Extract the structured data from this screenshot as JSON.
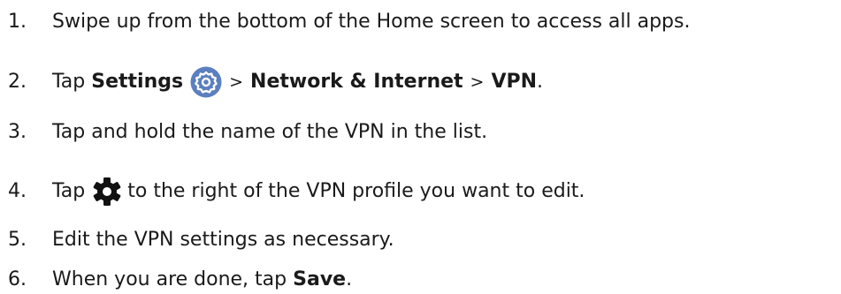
{
  "steps": [
    {
      "number": "1.",
      "text": "Swipe up from the bottom of the Home screen to access all apps."
    },
    {
      "number": "2.",
      "prefix": "Tap ",
      "settings": "Settings",
      "sep1": ">",
      "network": "Network & Internet",
      "sep2": ">",
      "vpn": "VPN",
      "suffix": "."
    },
    {
      "number": "3.",
      "text": "Tap and hold the name of the VPN in the list."
    },
    {
      "number": "4.",
      "prefix": "Tap",
      "suffix": "to the right of the VPN profile you want to edit."
    },
    {
      "number": "5.",
      "text": "Edit the VPN settings as necessary."
    },
    {
      "number": "6.",
      "prefix": "When you are done, tap ",
      "save": "Save",
      "suffix": "."
    }
  ],
  "icons": {
    "settings": "settings-app-icon",
    "gear": "gear-icon"
  },
  "colors": {
    "settings_icon_bg": "#5b7fbf",
    "gear": "#111111",
    "text": "#1a1a1a"
  }
}
